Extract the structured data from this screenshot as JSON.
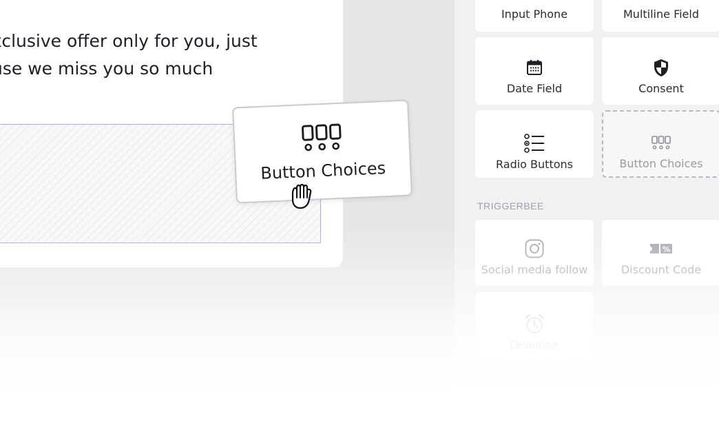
{
  "canvas": {
    "offer_line_1": "xclusive offer only for you, just",
    "offer_line_2": "use we miss you so much"
  },
  "sidebar": {
    "tiles": [
      {
        "label": "Input Phone",
        "icon": "phone-icon"
      },
      {
        "label": "Multiline Field",
        "icon": "multiline-icon"
      },
      {
        "label": "Date Field",
        "icon": "calendar-icon"
      },
      {
        "label": "Consent",
        "icon": "shield-icon"
      },
      {
        "label": "Radio Buttons",
        "icon": "radio-list-icon"
      },
      {
        "label": "Button Choices",
        "icon": "button-choices-icon"
      }
    ],
    "section_title": "TRIGGERBEE",
    "triggerbee_tiles": [
      {
        "label": "Social media follow",
        "icon": "instagram-icon"
      },
      {
        "label": "Discount Code",
        "icon": "discount-code-icon"
      },
      {
        "label": "Deadline",
        "icon": "alarm-clock-icon"
      }
    ]
  },
  "drag_ghost": {
    "label": "Button Choices",
    "icon": "button-choices-icon"
  },
  "colors": {
    "drop_zone_border": "#a8acf0",
    "placeholder_border": "#b9b9c0",
    "canvas_bg": "#e6e6e8",
    "sidebar_bg": "#f1f1f3"
  }
}
